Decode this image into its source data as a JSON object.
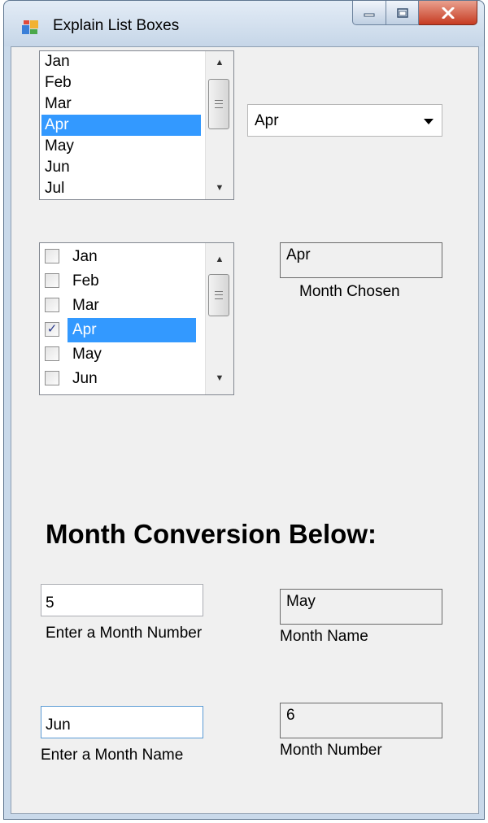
{
  "window": {
    "title": "Explain List Boxes",
    "icon": "form-app-icon",
    "controls": [
      "minimize-icon",
      "maximize-icon",
      "close-icon"
    ]
  },
  "month_listbox": {
    "items": [
      "Jan",
      "Feb",
      "Mar",
      "Apr",
      "May",
      "Jun",
      "Jul"
    ],
    "selected": "Apr"
  },
  "month_combobox": {
    "value": "Apr"
  },
  "month_checked_listbox": {
    "items": [
      {
        "label": "Jan",
        "checked": false
      },
      {
        "label": "Feb",
        "checked": false
      },
      {
        "label": "Mar",
        "checked": false
      },
      {
        "label": "Apr",
        "checked": true
      },
      {
        "label": "May",
        "checked": false
      },
      {
        "label": "Jun",
        "checked": false
      }
    ],
    "selected": "Apr",
    "check_mark": "✓"
  },
  "month_chosen": {
    "value": "Apr",
    "caption": "Month Chosen"
  },
  "conversion": {
    "heading": "Month Conversion Below:",
    "number_input": {
      "value": "5",
      "caption": "Enter a Month Number"
    },
    "month_name_output": {
      "value": "May",
      "caption": "Month Name"
    },
    "name_input": {
      "value": "Jun",
      "caption": "Enter a Month Name"
    },
    "month_number_output": {
      "value": "6",
      "caption": "Month Number"
    }
  },
  "colors": {
    "selection": "#3399ff",
    "form_background": "#f0f0f0",
    "close_button": "#c63b22"
  }
}
